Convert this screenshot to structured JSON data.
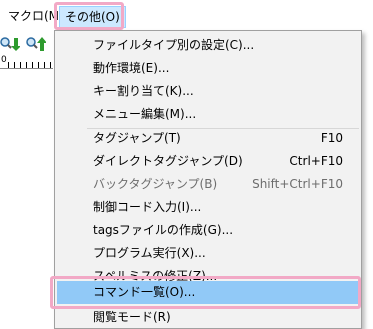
{
  "menubar": {
    "macro_label": "マクロ(M)",
    "other_label": "その他(O)"
  },
  "toolbar": {
    "icons": [
      "search-next-down-icon",
      "search-next-up-icon"
    ],
    "ruler_origin": "0"
  },
  "dropdown": {
    "items": [
      {
        "label": "ファイルタイプ別の設定(C)...",
        "shortcut": ""
      },
      {
        "label": "動作環境(E)...",
        "shortcut": ""
      },
      {
        "label": "キー割り当て(K)...",
        "shortcut": ""
      },
      {
        "label": "メニュー編集(M)...",
        "shortcut": ""
      },
      {
        "label": "タグジャンプ(T)",
        "shortcut": "F10"
      },
      {
        "label": "ダイレクトタグジャンプ(D)",
        "shortcut": "Ctrl+F10"
      },
      {
        "label": "バックタグジャンプ(B)",
        "shortcut": "Shift+Ctrl+F10",
        "disabled": true
      },
      {
        "label": "制御コード入力(I)...",
        "shortcut": ""
      },
      {
        "label": "tagsファイルの作成(G)...",
        "shortcut": ""
      },
      {
        "label": "プログラム実行(X)...",
        "shortcut": ""
      },
      {
        "label": "スペルミスの修正(Z)...",
        "shortcut": ""
      },
      {
        "label": "コマンド一覧(O)...",
        "shortcut": "",
        "selected": true
      },
      {
        "label": "閲覧モード(R)",
        "shortcut": ""
      }
    ]
  },
  "colors": {
    "highlight_outline": "#f2a9c6",
    "menubar_active_bg": "#cce8ff",
    "selected_item_bg": "#91c9f7",
    "menu_bg": "#f2f2f2",
    "disabled_text": "#6d6d6d"
  }
}
